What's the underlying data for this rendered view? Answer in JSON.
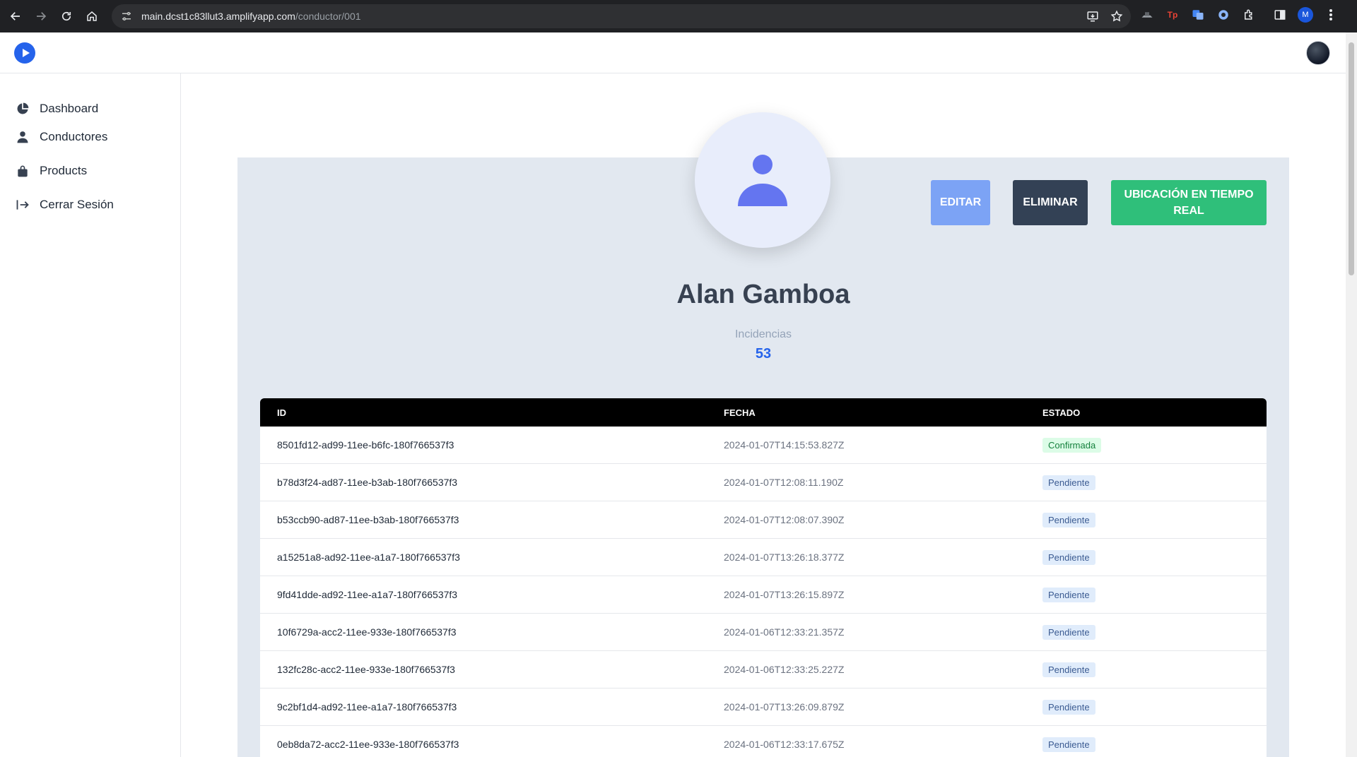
{
  "browser": {
    "url_host": "main.dcst1c83llut3.amplifyapp.com",
    "url_path": "/conductor/001",
    "profile_initial": "M",
    "extensions": [
      "Tp"
    ]
  },
  "sidebar": {
    "items": [
      {
        "label": "Dashboard",
        "icon": "pie-chart-icon"
      },
      {
        "label": "Conductores",
        "icon": "user-icon"
      },
      {
        "label": "Products",
        "icon": "lock-bag-icon"
      },
      {
        "label": "Cerrar Sesión",
        "icon": "logout-icon"
      }
    ]
  },
  "profile": {
    "name": "Alan Gamboa",
    "incidents_label": "Incidencias",
    "incidents_count": "53"
  },
  "actions": {
    "edit": "EDITAR",
    "delete": "ELIMINAR",
    "live_location": "UBICACIÓN EN TIEMPO REAL"
  },
  "colors": {
    "edit_button": "#7ca3f5",
    "delete_button": "#334155",
    "live_button": "#2fbf7a",
    "card_background": "#e2e8f0",
    "accent": "#2563eb"
  },
  "table": {
    "headers": {
      "id": "ID",
      "date": "FECHA",
      "state": "ESTADO"
    },
    "rows": [
      {
        "id": "8501fd12-ad99-11ee-b6fc-180f766537f3",
        "date": "2024-01-07T14:15:53.827Z",
        "state": "Confirmada"
      },
      {
        "id": "b78d3f24-ad87-11ee-b3ab-180f766537f3",
        "date": "2024-01-07T12:08:11.190Z",
        "state": "Pendiente"
      },
      {
        "id": "b53ccb90-ad87-11ee-b3ab-180f766537f3",
        "date": "2024-01-07T12:08:07.390Z",
        "state": "Pendiente"
      },
      {
        "id": "a15251a8-ad92-11ee-a1a7-180f766537f3",
        "date": "2024-01-07T13:26:18.377Z",
        "state": "Pendiente"
      },
      {
        "id": "9fd41dde-ad92-11ee-a1a7-180f766537f3",
        "date": "2024-01-07T13:26:15.897Z",
        "state": "Pendiente"
      },
      {
        "id": "10f6729a-acc2-11ee-933e-180f766537f3",
        "date": "2024-01-06T12:33:21.357Z",
        "state": "Pendiente"
      },
      {
        "id": "132fc28c-acc2-11ee-933e-180f766537f3",
        "date": "2024-01-06T12:33:25.227Z",
        "state": "Pendiente"
      },
      {
        "id": "9c2bf1d4-ad92-11ee-a1a7-180f766537f3",
        "date": "2024-01-07T13:26:09.879Z",
        "state": "Pendiente"
      },
      {
        "id": "0eb8da72-acc2-11ee-933e-180f766537f3",
        "date": "2024-01-06T12:33:17.675Z",
        "state": "Pendiente"
      }
    ]
  }
}
